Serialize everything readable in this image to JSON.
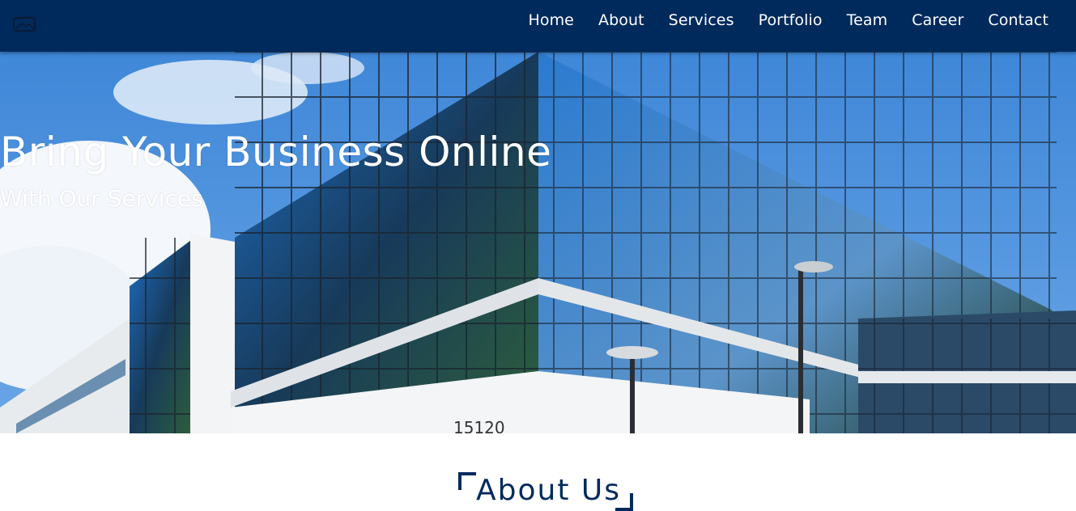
{
  "nav": {
    "logo_icon": "image-icon",
    "links": [
      "Home",
      "About",
      "Services",
      "Portfolio",
      "Team",
      "Career",
      "Contact"
    ]
  },
  "hero": {
    "title": "Bring Your Business Online",
    "subtitle": "With Our Services"
  },
  "about": {
    "title": "About Us"
  },
  "colors": {
    "navbar": "#002a5c",
    "sky": "#4a8fd6",
    "heading": "#002a5c",
    "text_light": "#ffffff"
  }
}
